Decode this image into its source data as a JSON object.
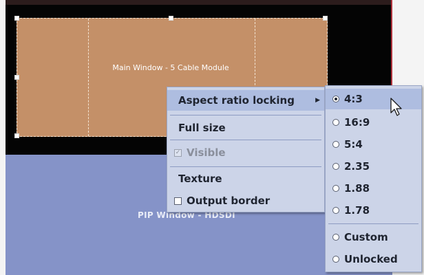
{
  "canvas": {
    "main_window_label": "Main Window - 5 Cable Module",
    "pip_window_label": "PIP Window - HDSDI"
  },
  "context_menu": {
    "items": [
      {
        "label": "Aspect ratio locking",
        "has_submenu": true,
        "highlighted": true
      },
      {
        "label": "Full size"
      },
      {
        "label": "Visible",
        "checkbox": true,
        "checked": true,
        "enabled": false
      },
      {
        "label": "Texture"
      },
      {
        "label": "Output border",
        "checkbox": true,
        "checked": false
      }
    ]
  },
  "submenu": {
    "items": [
      {
        "label": "4:3",
        "selected": true,
        "highlighted": true
      },
      {
        "label": "16:9",
        "selected": false
      },
      {
        "label": "5:4",
        "selected": false
      },
      {
        "label": "2.35",
        "selected": false
      },
      {
        "label": "1.88",
        "selected": false
      },
      {
        "label": "1.78",
        "selected": false
      },
      {
        "label": "Custom",
        "selected": false
      },
      {
        "label": "Unlocked",
        "selected": false
      }
    ]
  },
  "colors": {
    "main_window": "#c49068",
    "pip_window": "#8593c8",
    "menu_bg": "#ccd4e8",
    "menu_highlight": "#aebde0"
  }
}
